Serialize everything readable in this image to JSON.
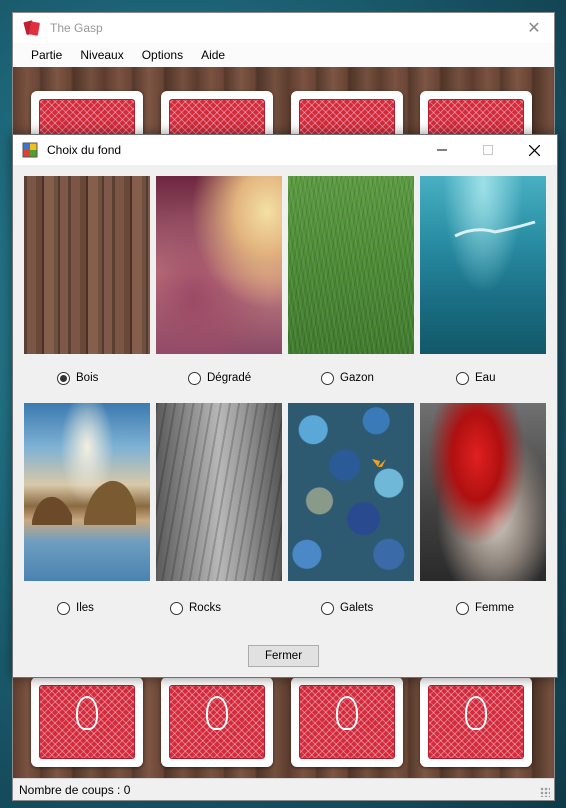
{
  "main_window": {
    "title": "The Gasp",
    "menu": [
      "Partie",
      "Niveaux",
      "Options",
      "Aide"
    ],
    "status": "Nombre de coups : 0"
  },
  "dialog": {
    "title": "Choix du fond",
    "options": [
      {
        "label": "Bois",
        "selected": true
      },
      {
        "label": "Dégradé",
        "selected": false
      },
      {
        "label": "Gazon",
        "selected": false
      },
      {
        "label": "Eau",
        "selected": false
      },
      {
        "label": "Iles",
        "selected": false
      },
      {
        "label": "Rocks",
        "selected": false
      },
      {
        "label": "Galets",
        "selected": false
      },
      {
        "label": "Femme",
        "selected": false
      }
    ],
    "close_button": "Fermer"
  },
  "colors": {
    "card_back": "#d32a3c",
    "dialog_bg": "#f0f0f0"
  }
}
